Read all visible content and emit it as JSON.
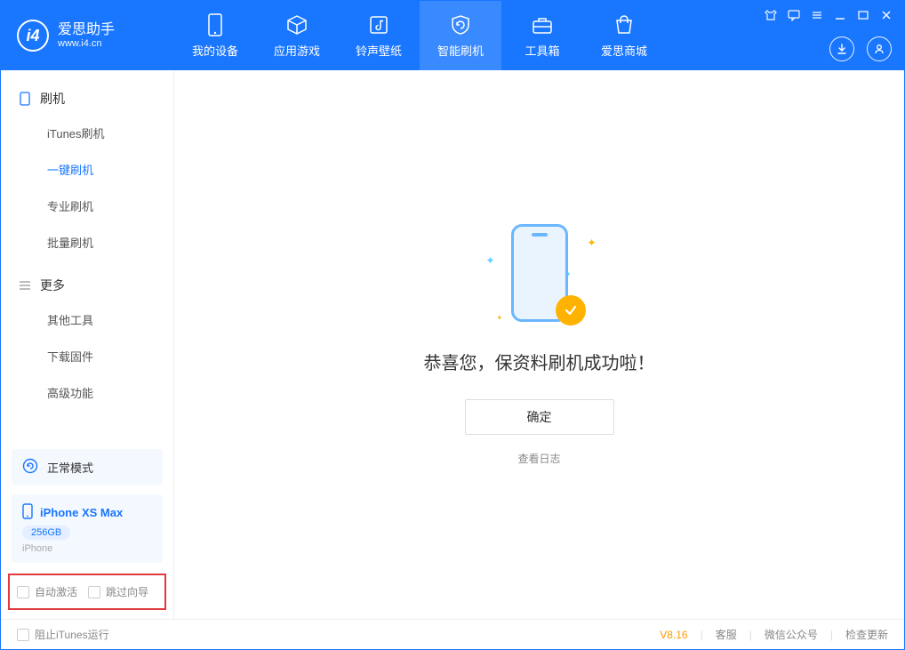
{
  "app": {
    "title": "爱思助手",
    "subtitle": "www.i4.cn"
  },
  "nav": {
    "tabs": [
      {
        "label": "我的设备",
        "active": false
      },
      {
        "label": "应用游戏",
        "active": false
      },
      {
        "label": "铃声壁纸",
        "active": false
      },
      {
        "label": "智能刷机",
        "active": true
      },
      {
        "label": "工具箱",
        "active": false
      },
      {
        "label": "爱思商城",
        "active": false
      }
    ]
  },
  "sidebar": {
    "group1": {
      "title": "刷机",
      "items": [
        {
          "label": "iTunes刷机",
          "active": false
        },
        {
          "label": "一键刷机",
          "active": true
        },
        {
          "label": "专业刷机",
          "active": false
        },
        {
          "label": "批量刷机",
          "active": false
        }
      ]
    },
    "group2": {
      "title": "更多",
      "items": [
        {
          "label": "其他工具"
        },
        {
          "label": "下载固件"
        },
        {
          "label": "高级功能"
        }
      ]
    },
    "mode_label": "正常模式",
    "device": {
      "name": "iPhone XS Max",
      "storage": "256GB",
      "type": "iPhone"
    },
    "bottom_checks": {
      "auto_activate": "自动激活",
      "skip_guide": "跳过向导"
    }
  },
  "main": {
    "success_text": "恭喜您，保资料刷机成功啦！",
    "ok_button": "确定",
    "view_log": "查看日志"
  },
  "footer": {
    "block_itunes": "阻止iTunes运行",
    "version": "V8.16",
    "links": [
      "客服",
      "微信公众号",
      "检查更新"
    ]
  }
}
